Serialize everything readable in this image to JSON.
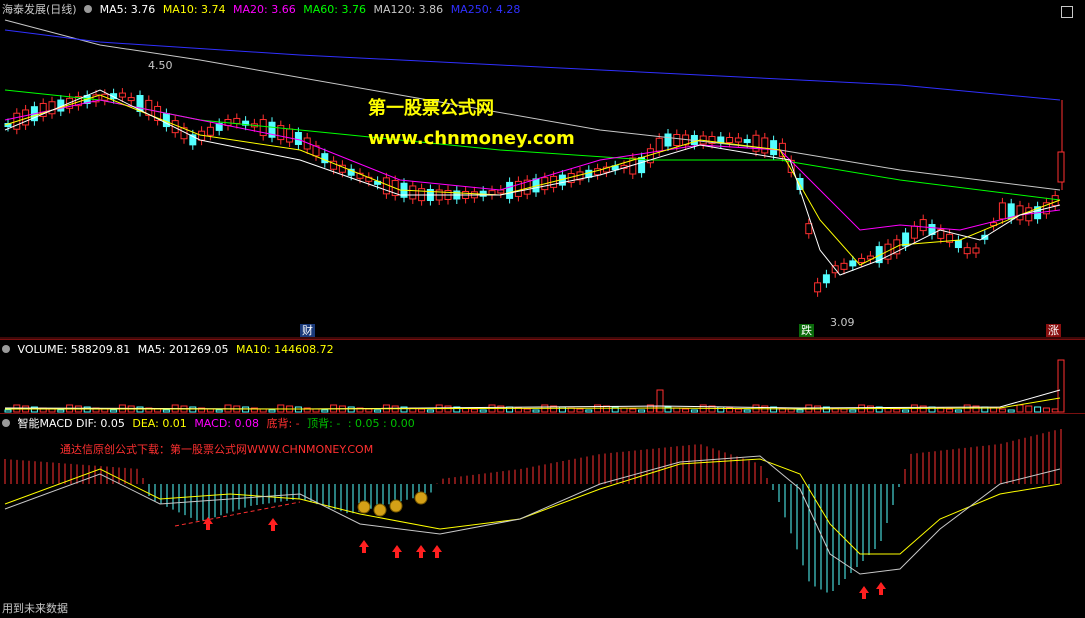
{
  "price_panel": {
    "title": "海泰发展(日线)",
    "indicators": [
      {
        "label": "MA5: 3.76",
        "color": "#ffffff"
      },
      {
        "label": "MA10: 3.74",
        "color": "#ffff00"
      },
      {
        "label": "MA20: 3.66",
        "color": "#ff00ff"
      },
      {
        "label": "MA60: 3.76",
        "color": "#00ff00"
      },
      {
        "label": "MA120: 3.86",
        "color": "#c8c8c8"
      },
      {
        "label": "MA250: 4.28",
        "color": "#3030ff"
      }
    ],
    "high_label": "4.50",
    "low_label": "3.09",
    "watermark_title": "第一股票公式网",
    "watermark_url": "www.chnmoney.com",
    "markers": {
      "finance": "财",
      "fall": "跌",
      "rise": "涨"
    }
  },
  "volume_panel": {
    "indicators": [
      {
        "label": "VOLUME: 588209.81",
        "color": "#ffffff"
      },
      {
        "label": "MA5: 201269.05",
        "color": "#ffffff"
      },
      {
        "label": "MA10: 144608.72",
        "color": "#ffff00"
      }
    ]
  },
  "macd_panel": {
    "indicators": [
      {
        "label": "智能MACD DIF: 0.05",
        "color": "#ffffff"
      },
      {
        "label": "DEA: 0.01",
        "color": "#ffff00"
      },
      {
        "label": "MACD: 0.08",
        "color": "#ff00ff"
      },
      {
        "label": "底背: -",
        "color": "#ff3030"
      },
      {
        "label": "顶背: -",
        "color": "#00c000"
      },
      {
        "label": ": 0.05 : 0.00",
        "color": "#00c000"
      }
    ],
    "download_note": "通达信原创公式下载：第一股票公式网WWW.CHNMONEY.COM",
    "bottom_note": "用到未来数据"
  }
}
